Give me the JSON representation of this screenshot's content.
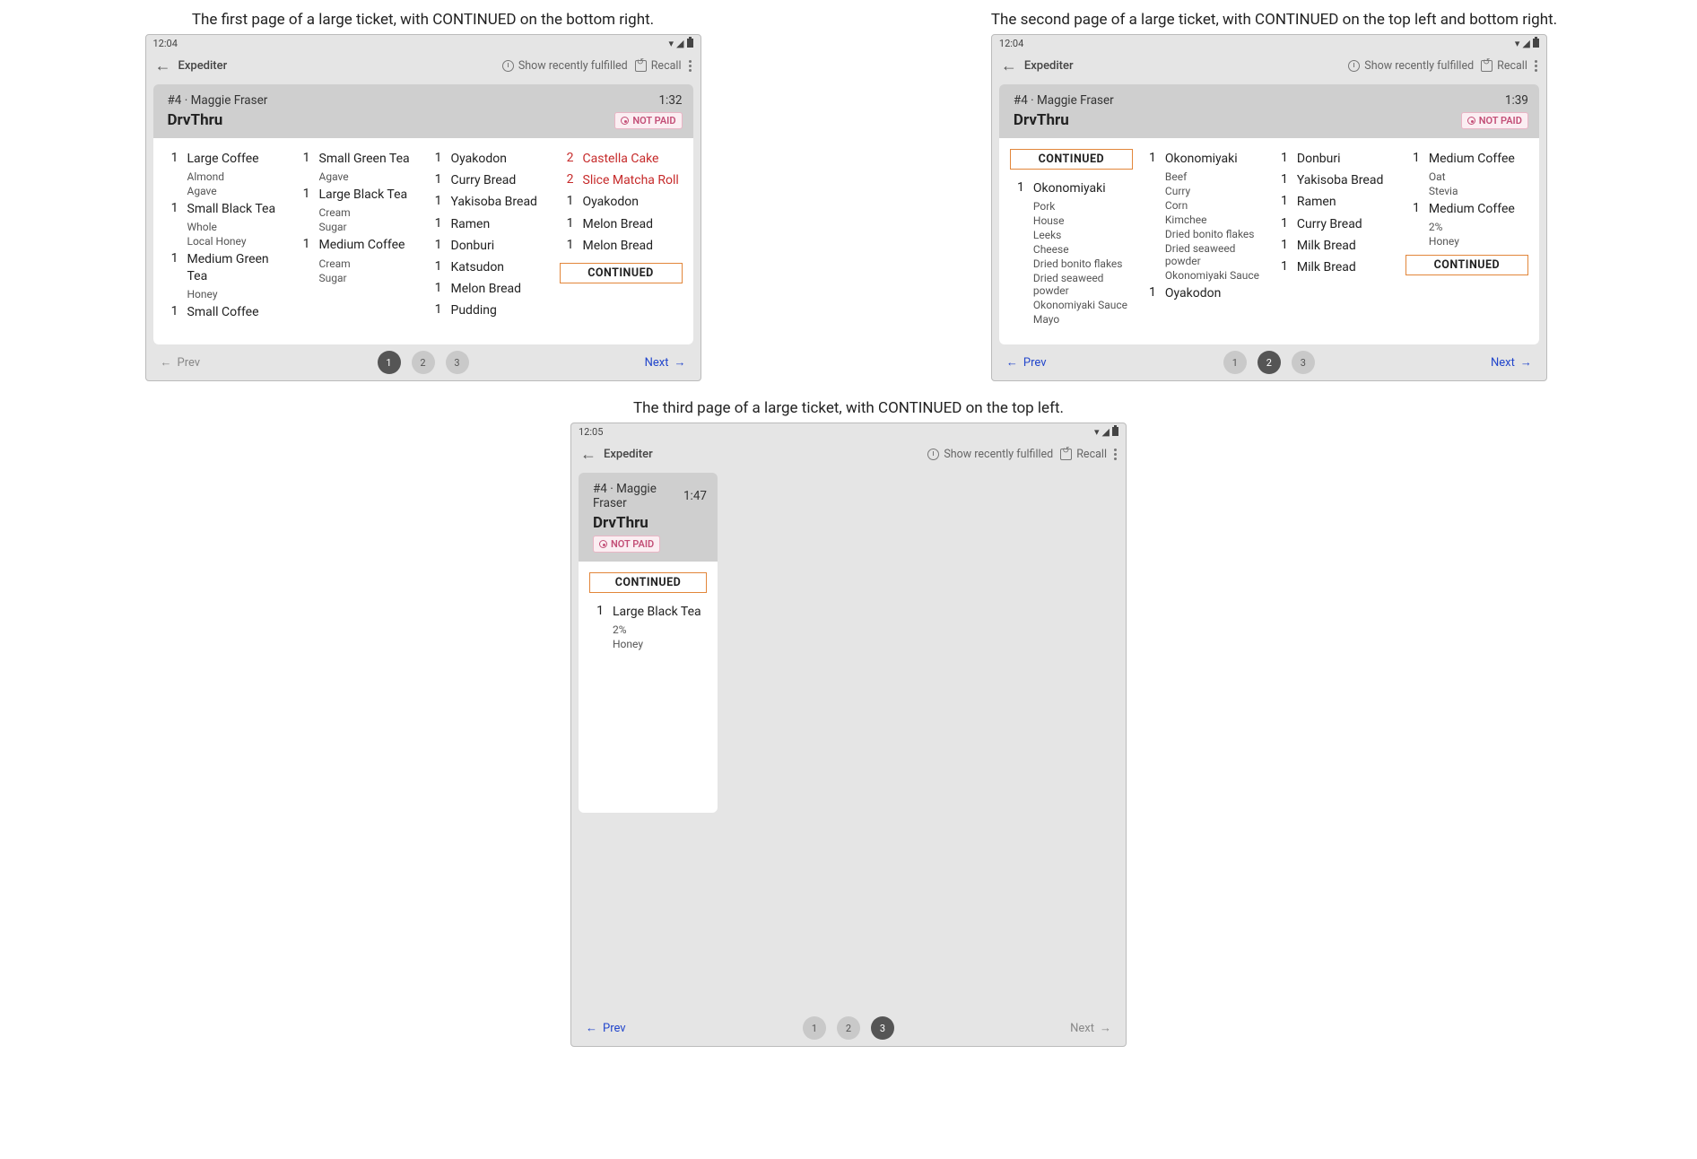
{
  "captions": {
    "p1": "The first page of a large ticket, with CONTINUED on the bottom right.",
    "p2": "The second page of a large ticket, with CONTINUED on the top left and bottom right.",
    "p3": "The third page of a large ticket, with CONTINUED on the top left."
  },
  "toolbar": {
    "title": "Expediter",
    "recent": "Show recently fulfilled",
    "recall": "Recall"
  },
  "status": {
    "t1": "12:04",
    "t2": "12:04",
    "t3": "12:05"
  },
  "ticket": {
    "order": "#4 · Maggie Fraser",
    "source": "DrvThru",
    "notpaid": "NOT PAID",
    "continued": "CONTINUED",
    "time_p1": "1:32",
    "time_p2": "1:39",
    "time_p3": "1:47"
  },
  "pager": {
    "prev": "Prev",
    "next": "Next",
    "d1": "1",
    "d2": "2",
    "d3": "3"
  },
  "page1": {
    "c1": [
      {
        "qty": "1",
        "name": "Large Coffee",
        "mods": [
          "Almond",
          "Agave"
        ]
      },
      {
        "qty": "1",
        "name": "Small Black Tea",
        "mods": [
          "Whole",
          "Local Honey"
        ]
      },
      {
        "qty": "1",
        "name": "Medium Green Tea",
        "mods": [
          "Honey"
        ]
      },
      {
        "qty": "1",
        "name": "Small Coffee",
        "mods": []
      }
    ],
    "c2": [
      {
        "qty": "1",
        "name": "Small Green Tea",
        "mods": [
          "Agave"
        ]
      },
      {
        "qty": "1",
        "name": "Large Black Tea",
        "mods": [
          "Cream",
          "Sugar"
        ]
      },
      {
        "qty": "1",
        "name": "Medium Coffee",
        "mods": [
          "Cream",
          "Sugar"
        ]
      }
    ],
    "c3": [
      {
        "qty": "1",
        "name": "Oyakodon",
        "mods": []
      },
      {
        "qty": "1",
        "name": "Curry Bread",
        "mods": []
      },
      {
        "qty": "1",
        "name": "Yakisoba Bread",
        "mods": []
      },
      {
        "qty": "1",
        "name": "Ramen",
        "mods": []
      },
      {
        "qty": "1",
        "name": "Donburi",
        "mods": []
      },
      {
        "qty": "1",
        "name": "Katsudon",
        "mods": []
      },
      {
        "qty": "1",
        "name": "Melon Bread",
        "mods": []
      },
      {
        "qty": "1",
        "name": "Pudding",
        "mods": []
      }
    ],
    "c4": [
      {
        "qty": "2",
        "name": "Castella Cake",
        "mods": [],
        "red": true
      },
      {
        "qty": "2",
        "name": "Slice Matcha Roll",
        "mods": [],
        "red": true
      },
      {
        "qty": "1",
        "name": "Oyakodon",
        "mods": []
      },
      {
        "qty": "1",
        "name": "Melon Bread",
        "mods": []
      },
      {
        "qty": "1",
        "name": "Melon Bread",
        "mods": []
      }
    ]
  },
  "page2": {
    "c1": [
      {
        "qty": "1",
        "name": "Okonomiyaki",
        "mods": [
          "Pork",
          "House",
          "Leeks",
          "Cheese",
          "Dried bonito flakes",
          "Dried seaweed powder",
          "Okonomiyaki Sauce",
          "Mayo"
        ]
      }
    ],
    "c2": [
      {
        "qty": "1",
        "name": "Okonomiyaki",
        "mods": [
          "Beef",
          "Curry",
          "Corn",
          "Kimchee",
          "Dried bonito flakes",
          "Dried seaweed powder",
          "Okonomiyaki Sauce"
        ]
      },
      {
        "qty": "1",
        "name": "Oyakodon",
        "mods": []
      }
    ],
    "c3": [
      {
        "qty": "1",
        "name": "Donburi",
        "mods": []
      },
      {
        "qty": "1",
        "name": "Yakisoba Bread",
        "mods": []
      },
      {
        "qty": "1",
        "name": "Ramen",
        "mods": []
      },
      {
        "qty": "1",
        "name": "Curry Bread",
        "mods": []
      },
      {
        "qty": "1",
        "name": "Milk Bread",
        "mods": []
      },
      {
        "qty": "1",
        "name": "Milk Bread",
        "mods": []
      }
    ],
    "c4": [
      {
        "qty": "1",
        "name": "Medium Coffee",
        "mods": [
          "Oat",
          "Stevia"
        ]
      },
      {
        "qty": "1",
        "name": "Medium Coffee",
        "mods": [
          "2%",
          "Honey"
        ]
      }
    ]
  },
  "page3": {
    "c1": [
      {
        "qty": "1",
        "name": "Large Black Tea",
        "mods": [
          "2%",
          "Honey"
        ]
      }
    ]
  }
}
